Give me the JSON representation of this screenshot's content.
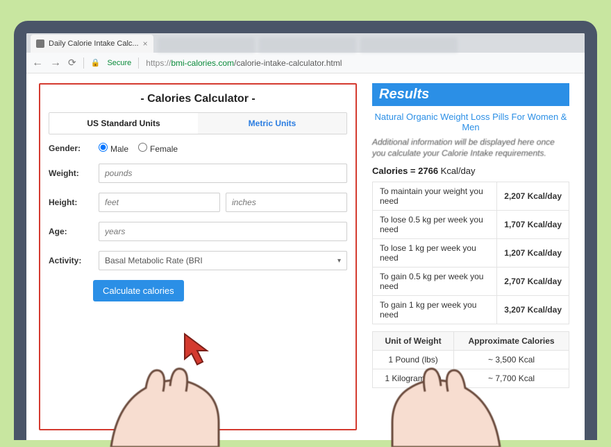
{
  "tab": {
    "title": "Daily Calorie Intake Calc..."
  },
  "omnibox": {
    "secure": "Secure",
    "scheme": "https://",
    "host": "bmi-calories.com",
    "path": "/calorie-intake-calculator.html"
  },
  "calculator": {
    "title": "- Calories Calculator -",
    "tabs": {
      "us": "US Standard Units",
      "metric": "Metric Units"
    },
    "labels": {
      "gender": "Gender:",
      "weight": "Weight:",
      "height": "Height:",
      "age": "Age:",
      "activity": "Activity:"
    },
    "gender": {
      "male": "Male",
      "female": "Female"
    },
    "placeholders": {
      "weight": "pounds",
      "height_ft": "feet",
      "height_in": "inches",
      "age": "years"
    },
    "activity_selected": "Basal Metabolic Rate (BRI",
    "button": "Calculate calories"
  },
  "results": {
    "header": "Results",
    "link": "Natural Organic Weight Loss Pills For Women & Men",
    "note": "Additional information will be displayed here once you calculate your Calorie Intake requirements.",
    "calorie_line_label": "Calories = ",
    "calorie_line_value": "2766",
    "calorie_line_unit": " Kcal/day",
    "rows": [
      {
        "text": "To maintain your weight you need",
        "value": "2,207 Kcal/day"
      },
      {
        "text": "To lose 0.5 kg per week you need",
        "value": "1,707 Kcal/day"
      },
      {
        "text": "To lose 1 kg per week you need",
        "value": "1,207 Kcal/day"
      },
      {
        "text": "To gain 0.5 kg per week you need",
        "value": "2,707 Kcal/day"
      },
      {
        "text": "To gain 1 kg per week you need",
        "value": "3,207 Kcal/day"
      }
    ],
    "unit_table": {
      "head_unit": "Unit of Weight",
      "head_cal": "Approximate Calories",
      "rows": [
        {
          "unit": "1 Pound (lbs)",
          "cal": "~ 3,500 Kcal"
        },
        {
          "unit": "1 Kilogram (kg)",
          "cal": "~ 7,700 Kcal"
        }
      ]
    }
  }
}
